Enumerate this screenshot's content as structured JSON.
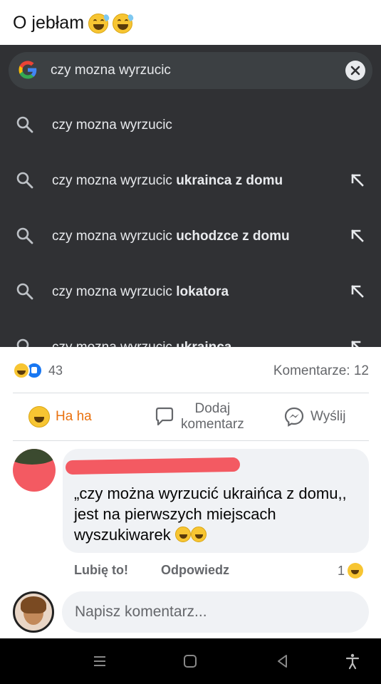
{
  "post": {
    "text": "O jebłam",
    "emoji_icons": [
      "grinning-sweat-emoji",
      "grinning-sweat-emoji"
    ]
  },
  "screenshot": {
    "search_query": "czy mozna wyrzucic",
    "suggestions": [
      {
        "prefix": "czy mozna wyrzucic",
        "bold": ""
      },
      {
        "prefix": "czy mozna wyrzucic ",
        "bold": "ukrainca z domu"
      },
      {
        "prefix": "czy mozna wyrzucic ",
        "bold": "uchodzce z domu"
      },
      {
        "prefix": "czy mozna wyrzucic ",
        "bold": "lokatora"
      },
      {
        "prefix": "czy mozna wyrzucic ",
        "bold": "ukrainca"
      }
    ],
    "colors": {
      "background": "#303134",
      "searchbar": "#3c4043",
      "text": "#e8eaed"
    }
  },
  "stats": {
    "reaction_count": "43",
    "comments_label": "Komentarze: 12"
  },
  "actions": {
    "haha": "Ha ha",
    "comment_line1": "Dodaj",
    "comment_line2": "komentarz",
    "send": "Wyślij"
  },
  "comment": {
    "text": "„czy można wyrzucić ukraińca z domu,, jest na pierwszych miejscach wyszukiwarek",
    "like": "Lubię to!",
    "reply": "Odpowiedz",
    "reaction_count": "1"
  },
  "composer": {
    "placeholder": "Napisz komentarz..."
  },
  "brand_colors": {
    "facebook_blue": "#1877f2",
    "haha_orange": "#e9710f",
    "redaction": "#f35a62"
  }
}
